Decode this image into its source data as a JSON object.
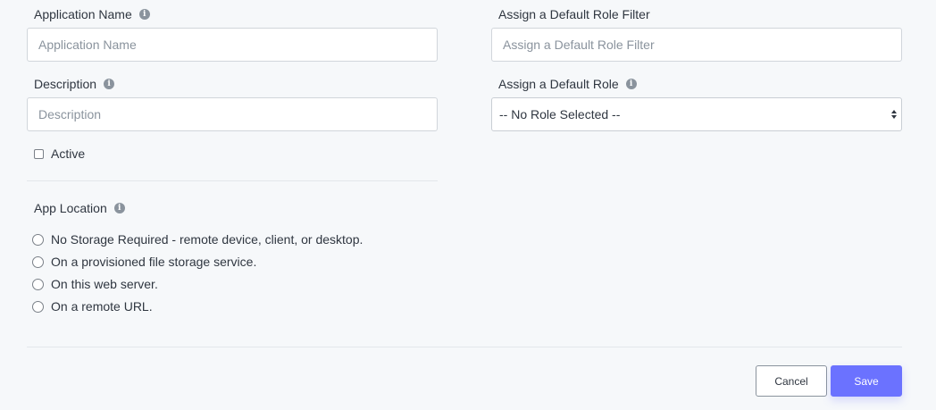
{
  "form": {
    "app_name": {
      "label": "Application Name",
      "placeholder": "Application Name",
      "value": ""
    },
    "description": {
      "label": "Description",
      "placeholder": "Description",
      "value": ""
    },
    "active": {
      "label": "Active",
      "checked": false
    },
    "role_filter": {
      "label": "Assign a Default Role Filter",
      "placeholder": "Assign a Default Role Filter",
      "value": ""
    },
    "default_role": {
      "label": "Assign a Default Role",
      "selected": "-- No Role Selected --"
    },
    "app_location": {
      "label": "App Location",
      "options": [
        {
          "label": "No Storage Required - remote device, client, or desktop.",
          "selected": false
        },
        {
          "label": "On a provisioned file storage service.",
          "selected": false
        },
        {
          "label": "On this web server.",
          "selected": false
        },
        {
          "label": "On a remote URL.",
          "selected": false
        }
      ]
    }
  },
  "actions": {
    "cancel_label": "Cancel",
    "save_label": "Save"
  },
  "icons": {
    "info": "info-icon",
    "select_arrows": "updown-arrows-icon"
  },
  "colors": {
    "accent": "#6b72ff",
    "background": "#f6f8fa"
  }
}
